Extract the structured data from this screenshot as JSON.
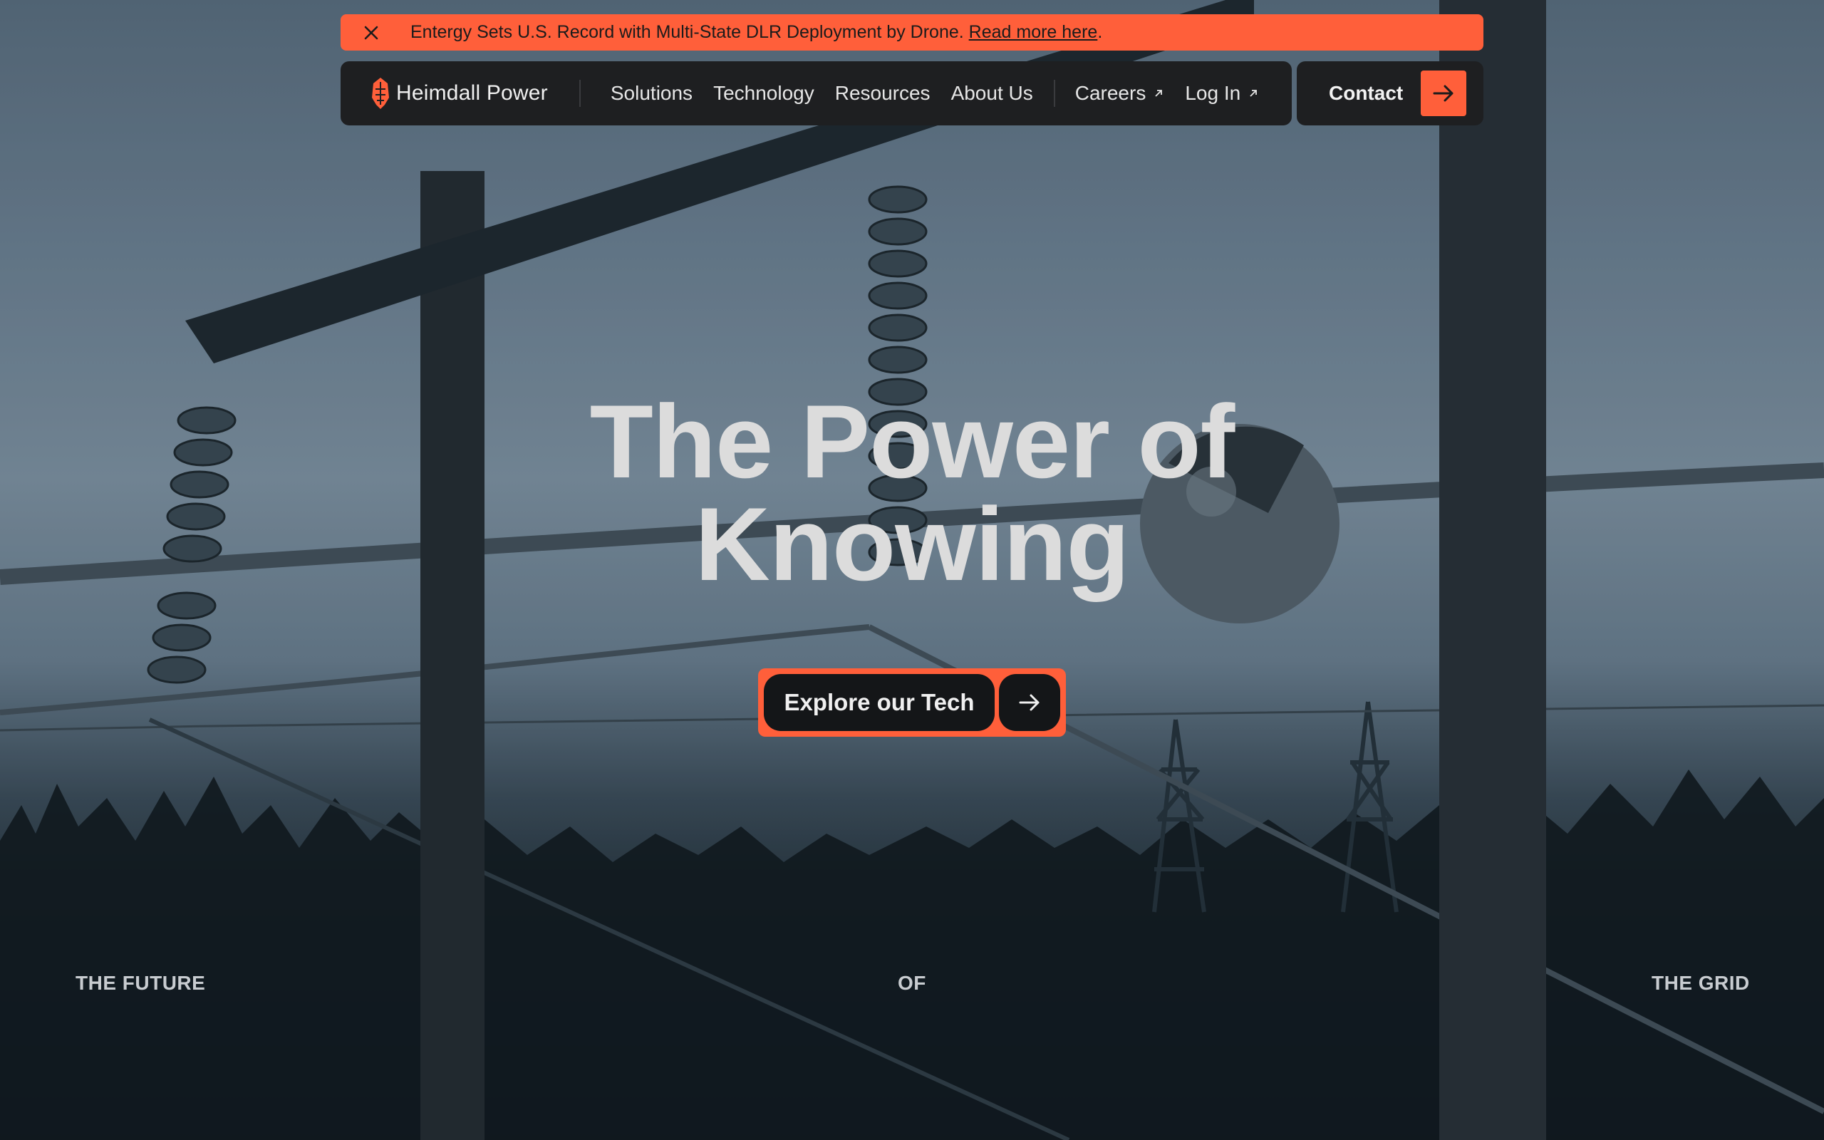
{
  "announcement": {
    "text": "Entergy Sets U.S. Record with Multi-State DLR Deployment by Drone. ",
    "link_text": "Read more here",
    "suffix": ".",
    "close_icon": "close-icon"
  },
  "nav": {
    "logo_text": "Heimdall Power",
    "items": [
      {
        "label": "Solutions"
      },
      {
        "label": "Technology"
      },
      {
        "label": "Resources"
      },
      {
        "label": "About Us"
      }
    ],
    "external_items": [
      {
        "label": "Careers",
        "icon": "external-arrow-icon"
      },
      {
        "label": "Log In",
        "icon": "external-arrow-icon"
      }
    ],
    "contact_label": "Contact",
    "contact_icon": "arrow-right-icon"
  },
  "hero": {
    "headline_line1": "The Power of",
    "headline_line2": "Knowing",
    "cta_label": "Explore our Tech",
    "cta_icon": "arrow-right-icon"
  },
  "tagline": {
    "left": "THE FUTURE",
    "middle": "OF",
    "right": "THE GRID"
  },
  "colors": {
    "accent": "#ff5f3a",
    "nav_bg": "#1e1f21",
    "text_light": "#dcdcdc"
  }
}
